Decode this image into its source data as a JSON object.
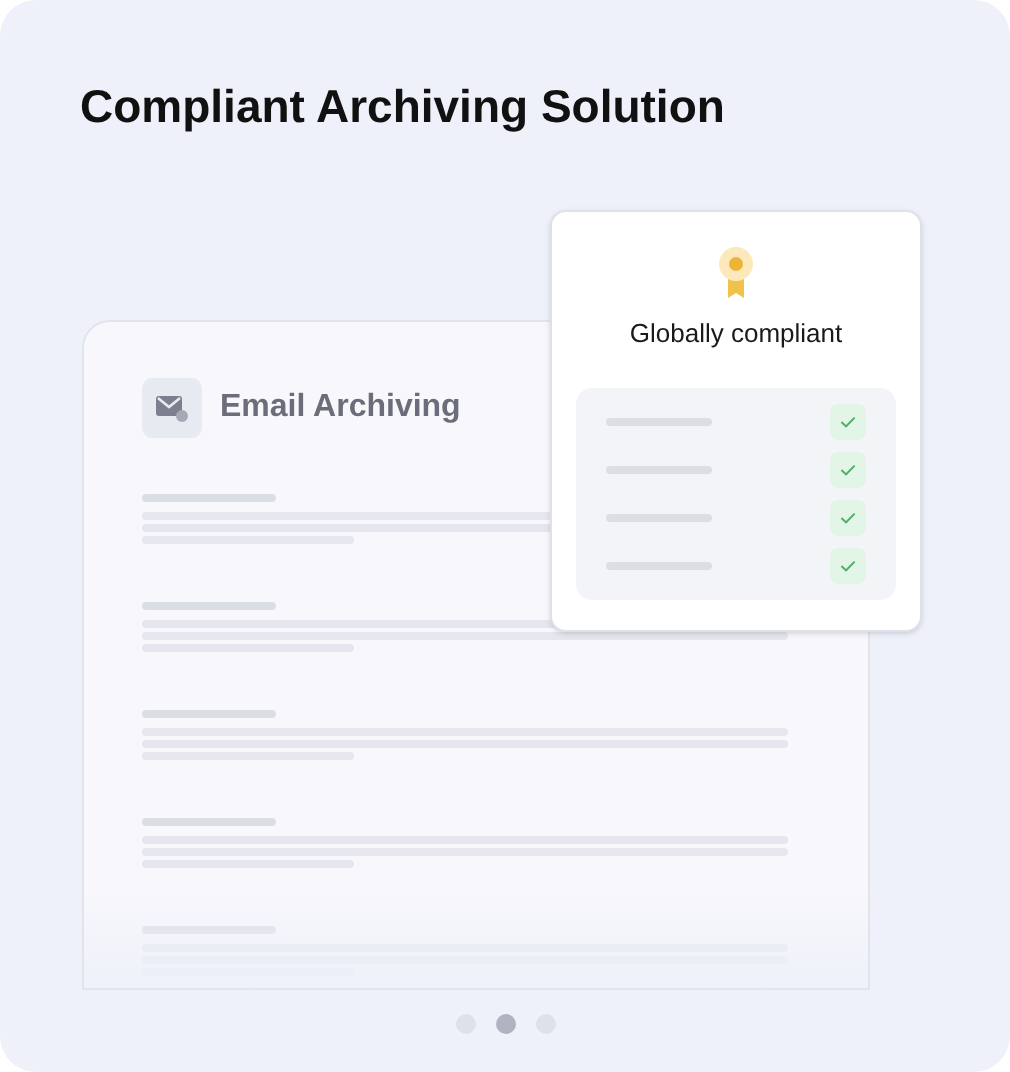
{
  "title": "Compliant Archiving Solution",
  "document": {
    "title": "Email Archiving"
  },
  "compliance_card": {
    "title": "Globally compliant",
    "items": [
      {
        "checked": true
      },
      {
        "checked": true
      },
      {
        "checked": true
      },
      {
        "checked": true
      }
    ]
  },
  "pagination": [
    {
      "selected": false
    },
    {
      "selected": true
    },
    {
      "selected": false
    }
  ]
}
